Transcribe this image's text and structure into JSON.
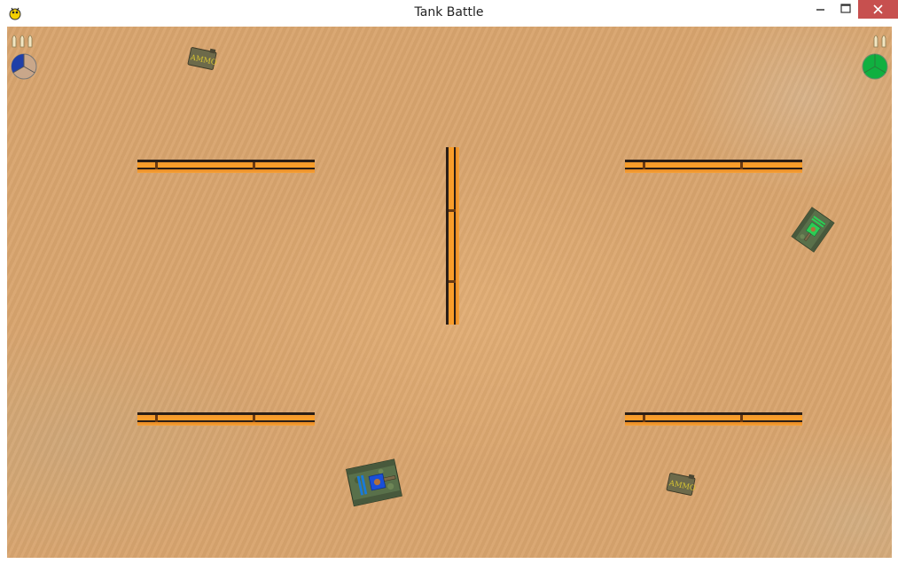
{
  "window": {
    "title": "Tank Battle",
    "icon": "pygame-snake-icon",
    "controls": [
      "minimize-icon",
      "maximize-icon",
      "close-icon"
    ]
  },
  "game": {
    "players": [
      {
        "id": "blue",
        "color": "#1f3fa8",
        "side": "left",
        "bullets": 3,
        "health_fraction": 0.33
      },
      {
        "id": "green",
        "color": "#10b040",
        "side": "right",
        "bullets": 2,
        "health_fraction": 1.0
      }
    ],
    "walls": 5,
    "ammo_crates": [
      {
        "label": "AMMO"
      },
      {
        "label": "AMMO"
      }
    ],
    "tanks": [
      {
        "team": "blue",
        "turret_color": "#1a4fd8"
      },
      {
        "team": "green",
        "turret_color": "#2ccc55"
      }
    ]
  },
  "colors": {
    "sand": "#d9a56e",
    "wall_orange": "#f29a2c",
    "wall_dark": "#2a1e16",
    "camo_green": "#59704a",
    "ammo_box": "#6d6a4a",
    "ammo_text": "#d9c633",
    "close_button": "#c7504f"
  }
}
